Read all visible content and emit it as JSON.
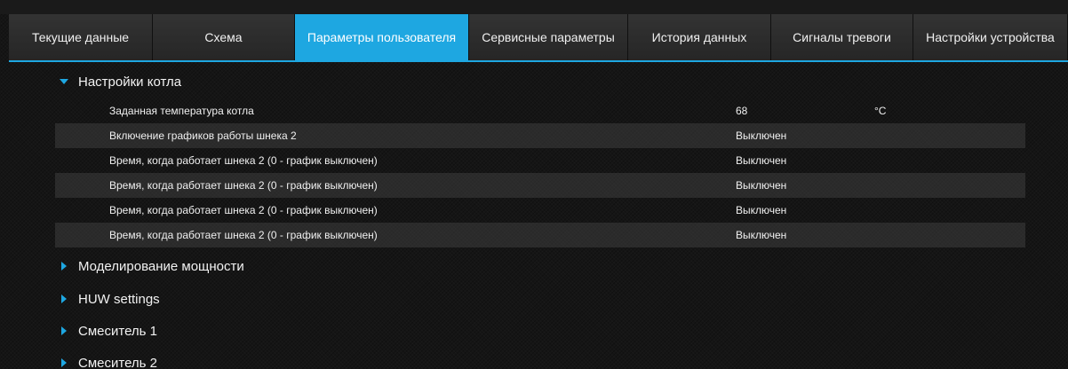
{
  "tabs": [
    {
      "label": "Текущие данные",
      "active": false
    },
    {
      "label": "Схема",
      "active": false
    },
    {
      "label": "Параметры пользователя",
      "active": true
    },
    {
      "label": "Сервисные параметры",
      "active": false
    },
    {
      "label": "История данных",
      "active": false
    },
    {
      "label": "Сигналы тревоги",
      "active": false
    },
    {
      "label": "Настройки устройства",
      "active": false
    }
  ],
  "accent_color": "#1ea7e1",
  "sections": [
    {
      "title": "Настройки котла",
      "expanded": true,
      "icon": "caret-down-icon",
      "rows": [
        {
          "label": "Заданная температура котла",
          "value": "68",
          "unit": "°C"
        },
        {
          "label": "Включение графиков работы шнека 2",
          "value": "Выключен",
          "unit": ""
        },
        {
          "label": "Время, когда работает шнека 2 (0 - график выключен)",
          "value": "Выключен",
          "unit": ""
        },
        {
          "label": "Время, когда работает шнека 2 (0 - график выключен)",
          "value": "Выключен",
          "unit": ""
        },
        {
          "label": "Время, когда работает шнека 2 (0 - график выключен)",
          "value": "Выключен",
          "unit": ""
        },
        {
          "label": "Время, когда работает шнека 2 (0 - график выключен)",
          "value": "Выключен",
          "unit": ""
        }
      ]
    },
    {
      "title": "Моделирование мощности",
      "expanded": false,
      "icon": "caret-right-icon"
    },
    {
      "title": "HUW settings",
      "expanded": false,
      "icon": "caret-right-icon"
    },
    {
      "title": "Смеситель 1",
      "expanded": false,
      "icon": "caret-right-icon"
    },
    {
      "title": "Смеситель 2",
      "expanded": false,
      "icon": "caret-right-icon"
    }
  ]
}
